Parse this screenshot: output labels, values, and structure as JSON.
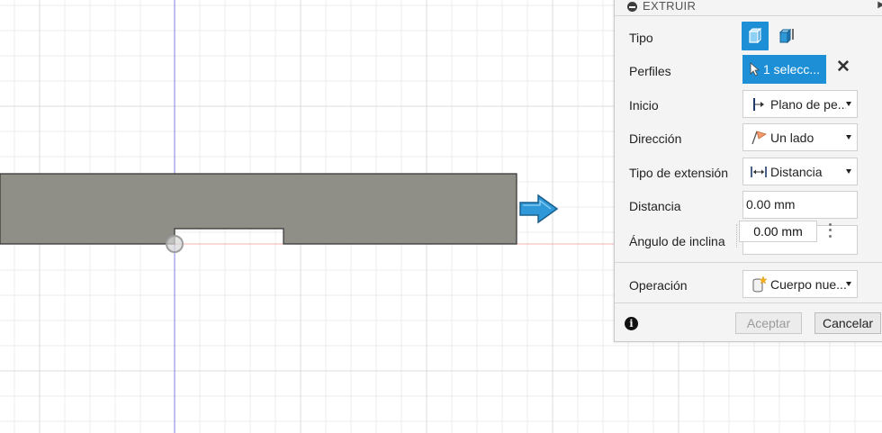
{
  "panel": {
    "title": "EXTRUIR",
    "rows": {
      "tipo": {
        "label": "Tipo"
      },
      "perfiles": {
        "label": "Perfiles",
        "value": "1 selecc..."
      },
      "inicio": {
        "label": "Inicio",
        "value": "Plano de pe..."
      },
      "direccion": {
        "label": "Dirección",
        "value": "Un lado"
      },
      "tipo_extension": {
        "label": "Tipo de extensión",
        "value": "Distancia"
      },
      "distancia": {
        "label": "Distancia",
        "value": "0.00 mm"
      },
      "angulo": {
        "label": "Ángulo de inclina",
        "value": "0.00 mm"
      },
      "operacion": {
        "label": "Operación",
        "value": "Cuerpo nue..."
      }
    },
    "footer": {
      "ok_label": "Aceptar",
      "cancel_label": "Cancelar"
    }
  },
  "colors": {
    "accent": "#1d8fd6",
    "sketch_fill": "#8f8f88",
    "grid": "#e6e6e6",
    "axis_blue": "#7777dd",
    "axis_red": "#f2a8a8",
    "arrow": "#2e98d8"
  },
  "icons": {
    "collapse": "collapse-dot-icon",
    "solid_type": "solid-body-icon",
    "surface_type": "surface-body-icon",
    "select": "cursor-arrow-icon",
    "clear": "close-icon",
    "start": "profile-plane-icon",
    "direction": "flag-icon",
    "extent": "distance-icon",
    "menu": "vertical-dots-icon",
    "operation": "new-body-icon",
    "info": "info-icon",
    "manipulator": "blue-arrow-manipulator-icon"
  }
}
